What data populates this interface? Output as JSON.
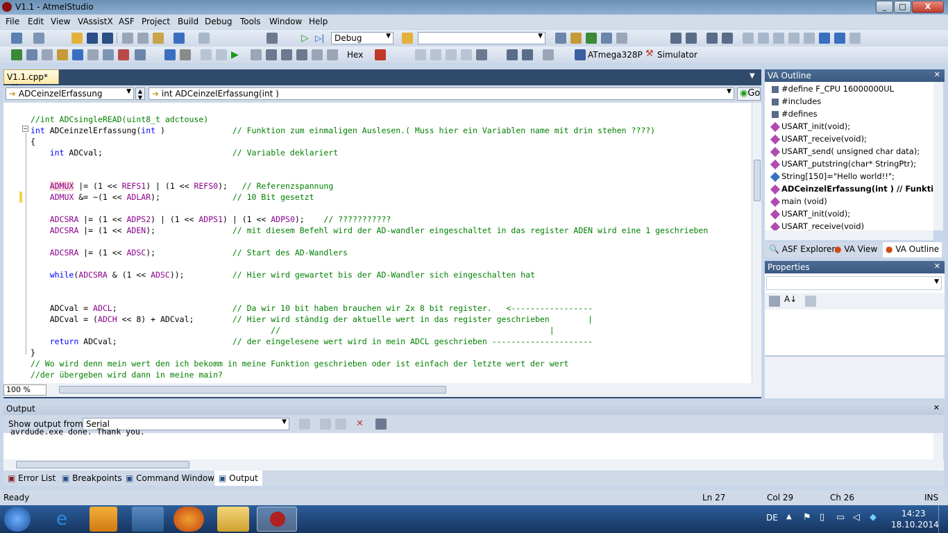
{
  "window": {
    "title": "V1.1 - AtmelStudio",
    "minimize": "_",
    "maximize": "□",
    "close": "X"
  },
  "menu": [
    "File",
    "Edit",
    "View",
    "VAssistX",
    "ASF",
    "Project",
    "Build",
    "Debug",
    "Tools",
    "Window",
    "Help"
  ],
  "toolbar": {
    "config": "Debug",
    "search_value": "",
    "hex_label": "Hex",
    "device": "ATmega328P",
    "tool": "Simulator"
  },
  "editor": {
    "tab_label": "V1.1.cpp*",
    "scope_combo": "ADCeinzelErfassung",
    "function_combo": "int ADCeinzelErfassung(int )",
    "go_button": "Go",
    "zoom": "100 %",
    "lines": [
      "//int ADCsingleREAD(uint8_t adctouse)",
      "int ADCeinzelErfassung(int )              // Funktion zum einmaligen Auslesen.( Muss hier ein Variablen name mit drin stehen ????)",
      "{",
      "    int ADCval;                           // Variable deklariert",
      "",
      "",
      "    ADMUX |= (1 << REFS1) | (1 << REFS0);   // Referenzspannung",
      "    ADMUX &= ~(1 << ADLAR);               // 10 Bit gesetzt",
      "",
      "    ADCSRA |= (1 << ADPS2) | (1 << ADPS1) | (1 << ADPS0);    // ???????????",
      "    ADCSRA |= (1 << ADEN);                // mit diesem Befehl wird der AD-wandler eingeschaltet in das register ADEN wird eine 1 geschrieben",
      "",
      "    ADCSRA |= (1 << ADSC);                // Start des AD-Wandlers",
      "",
      "    while(ADCSRA & (1 << ADSC));          // Hier wird gewartet bis der AD-Wandler sich eingeschalten hat",
      "",
      "",
      "    ADCval = ADCL;                        // Da wir 10 bit haben brauchen wir 2x 8 bit register.   <-----------------",
      "    ADCval = (ADCH << 8) + ADCval;        // Hier wird ständig der aktuelle wert in das register geschrieben        |",
      "                                                  //                                                        |",
      "    return ADCval;                        // der eingelesene wert wird in mein ADCL geschrieben ---------------------",
      "}",
      "// Wo wird denn mein wert den ich bekomm in meine Funktion geschrieben oder ist einfach der letzte wert der wert",
      "//der übergeben wird dann in meine main?"
    ]
  },
  "va_outline": {
    "title": "VA Outline",
    "items": [
      "#define F_CPU 16000000UL",
      "#includes",
      "#defines",
      "USART_init(void);",
      "USART_receive(void);",
      "USART_send( unsigned char data);",
      "USART_putstring(char* StringPtr);",
      "String[150]=\"Hello world!!\";",
      "ADCeinzelErfassung(int ) // Funktion",
      "main (void)",
      "USART_init(void);",
      "USART_receive(void)"
    ],
    "tabs": [
      "ASF Explorer",
      "VA View",
      "VA Outline"
    ]
  },
  "properties": {
    "title": "Properties"
  },
  "output": {
    "title": "Output",
    "show_from_label": "Show output from:",
    "source": "Serial",
    "text": "avrdude.exe done.  Thank you."
  },
  "bottom_tabs": [
    "Error List",
    "Breakpoints",
    "Command Window",
    "Output"
  ],
  "status": {
    "ready": "Ready",
    "ln": "Ln 27",
    "col": "Col 29",
    "ch": "Ch 26",
    "mode": "INS"
  },
  "taskbar": {
    "lang": "DE",
    "time": "14:23",
    "date": "18.10.2014"
  }
}
